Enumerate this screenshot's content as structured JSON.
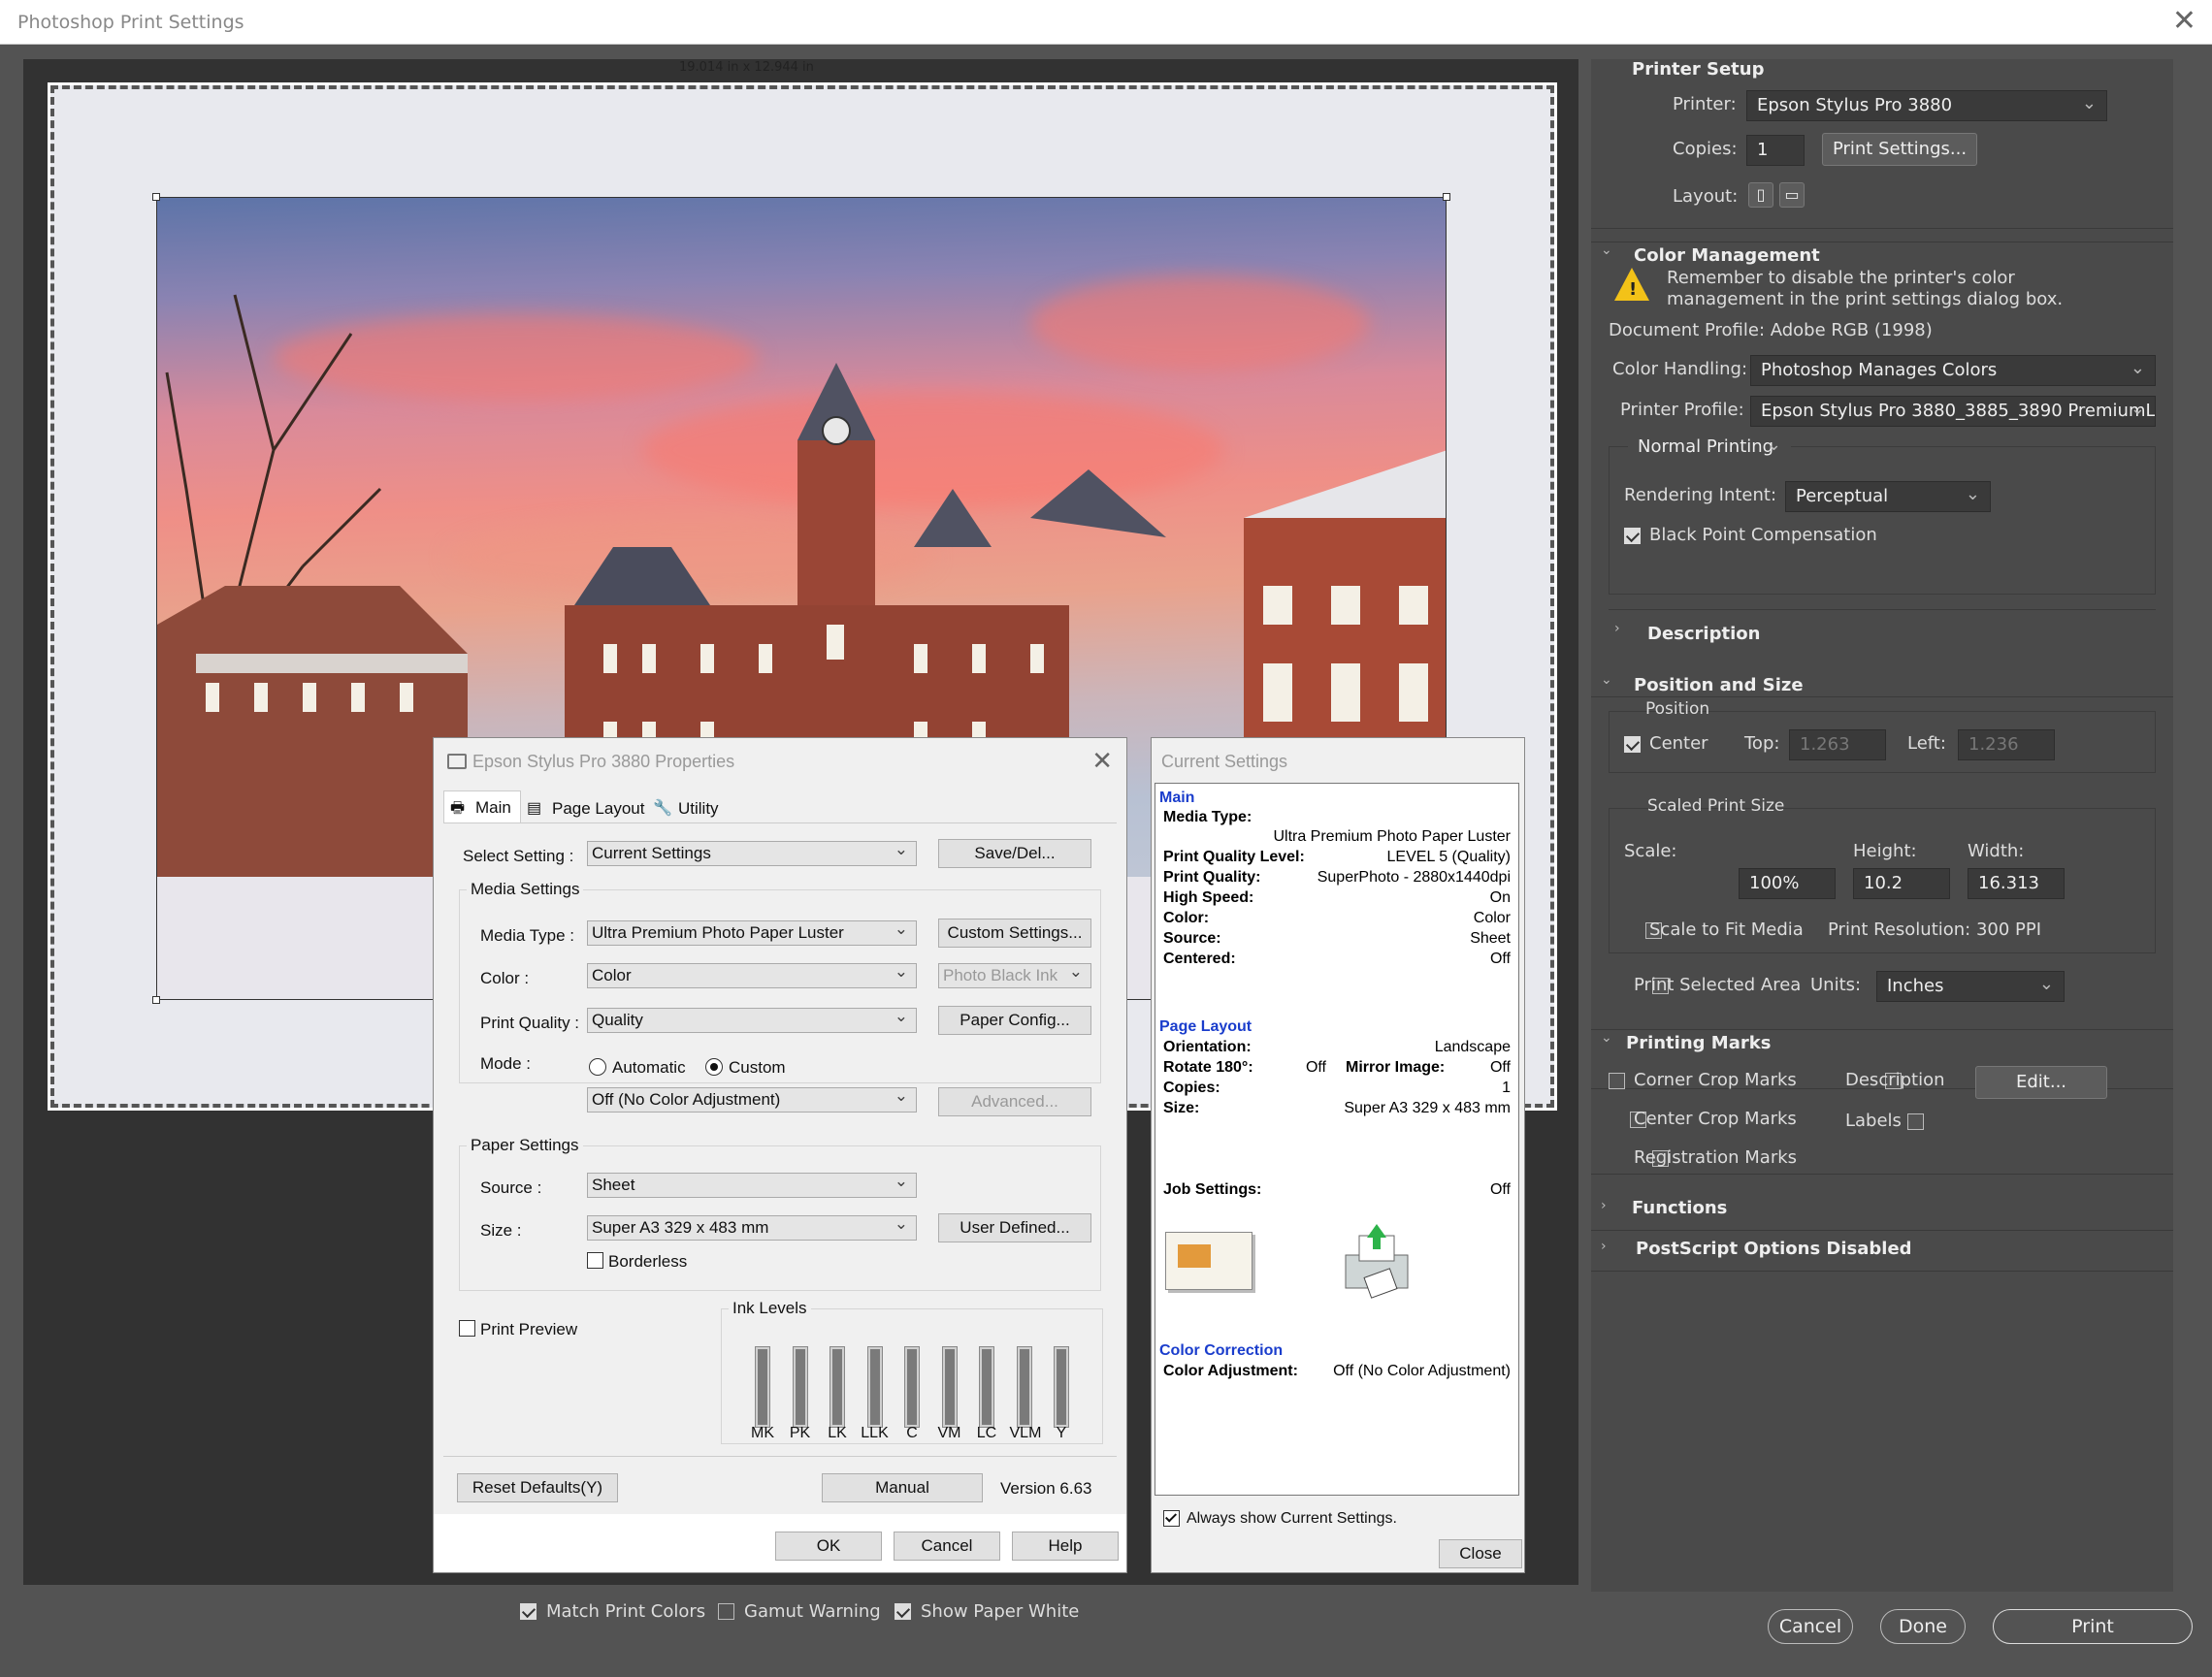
{
  "window": {
    "title": "Photoshop Print Settings",
    "close_glyph": "✕"
  },
  "preview": {
    "dimensions": "19.014 in x 12.944 in",
    "match_print_colors": {
      "label": "Match Print Colors",
      "checked": true
    },
    "gamut_warning": {
      "label": "Gamut Warning",
      "checked": false
    },
    "show_paper_white": {
      "label": "Show Paper White",
      "checked": true
    }
  },
  "printer_setup": {
    "header": "Printer Setup",
    "printer_label": "Printer:",
    "printer_value": "Epson Stylus Pro 3880",
    "copies_label": "Copies:",
    "copies_value": "1",
    "print_settings_button": "Print Settings...",
    "layout_label": "Layout:"
  },
  "color_management": {
    "header": "Color Management",
    "warning": "Remember to disable the printer's color management in the print settings dialog box.",
    "warning_line1": "Remember to disable the printer's color",
    "warning_line2": "management in the print settings dialog box.",
    "document_profile": "Document Profile: Adobe RGB (1998)",
    "color_handling_label": "Color Handling:",
    "color_handling_value": "Photoshop Manages Colors",
    "printer_profile_label": "Printer Profile:",
    "printer_profile_value": "Epson Stylus Pro 3880_3885_3890 PremiumL...",
    "print_mode_value": "Normal Printing",
    "rendering_intent_label": "Rendering Intent:",
    "rendering_intent_value": "Perceptual",
    "black_point": {
      "label": "Black Point Compensation",
      "checked": true
    }
  },
  "description": {
    "header": "Description"
  },
  "position_and_size": {
    "header": "Position and Size",
    "position_group": "Position",
    "center": {
      "label": "Center",
      "checked": true
    },
    "top_label": "Top:",
    "top_value": "1.263",
    "left_label": "Left:",
    "left_value": "1.236",
    "scaled_group": "Scaled Print Size",
    "scale_label": "Scale:",
    "scale_value": "100%",
    "height_label": "Height:",
    "height_value": "10.2",
    "width_label": "Width:",
    "width_value": "16.313",
    "scale_to_fit": {
      "label": "Scale to Fit Media",
      "checked": false
    },
    "print_resolution": "Print Resolution: 300 PPI",
    "print_selected_area": {
      "label": "Print Selected Area",
      "checked": false
    },
    "units_label": "Units:",
    "units_value": "Inches"
  },
  "printing_marks": {
    "header": "Printing Marks",
    "corner_crop": "Corner Crop Marks",
    "center_crop": "Center Crop Marks",
    "registration": "Registration Marks",
    "description": "Description",
    "labels": "Labels",
    "edit_button": "Edit..."
  },
  "functions": {
    "header": "Functions"
  },
  "postscript": {
    "header": "PostScript Options Disabled"
  },
  "footer": {
    "cancel": "Cancel",
    "done": "Done",
    "print": "Print"
  },
  "epson": {
    "title": "Epson Stylus Pro 3880 Properties",
    "tabs": [
      "Main",
      "Page Layout",
      "Utility"
    ],
    "select_setting_label": "Select Setting :",
    "select_setting_value": "Current Settings",
    "save_del": "Save/Del...",
    "media_settings": "Media Settings",
    "media_type_label": "Media Type :",
    "media_type_value": "Ultra Premium Photo Paper Luster",
    "custom_settings": "Custom Settings...",
    "color_label": "Color :",
    "color_value": "Color",
    "photo_black_ink": "Photo Black Ink",
    "print_quality_label": "Print Quality :",
    "print_quality_value": "Quality",
    "paper_config": "Paper Config...",
    "mode_label": "Mode :",
    "automatic": "Automatic",
    "custom": "Custom",
    "mode_value": "Off (No Color Adjustment)",
    "advanced": "Advanced...",
    "paper_settings": "Paper Settings",
    "source_label": "Source :",
    "source_value": "Sheet",
    "size_label": "Size :",
    "size_value": "Super A3 329 x 483 mm",
    "user_defined": "User Defined...",
    "borderless": "Borderless",
    "print_preview": "Print Preview",
    "ink_levels": "Ink Levels",
    "inks": [
      "MK",
      "PK",
      "LK",
      "LLK",
      "C",
      "VM",
      "LC",
      "VLM",
      "Y"
    ],
    "reset_defaults": "Reset Defaults(Y)",
    "manual": "Manual",
    "version": "Version 6.63",
    "ok": "OK",
    "cancel": "Cancel",
    "help": "Help"
  },
  "current_settings": {
    "title": "Current Settings",
    "main_header": "Main",
    "media_type_k": "Media Type:",
    "media_type_v": "Ultra Premium Photo Paper Luster",
    "pql_k": "Print Quality Level:",
    "pql_v": "LEVEL 5 (Quality)",
    "pq_k": "Print Quality:",
    "pq_v": "SuperPhoto - 2880x1440dpi",
    "hs_k": "High Speed:",
    "hs_v": "On",
    "color_k": "Color:",
    "color_v": "Color",
    "source_k": "Source:",
    "source_v": "Sheet",
    "centered_k": "Centered:",
    "centered_v": "Off",
    "page_layout_header": "Page Layout",
    "orientation_k": "Orientation:",
    "orientation_v": "Landscape",
    "rotate_k": "Rotate 180°:",
    "rotate_v": "Off",
    "mirror_k": "Mirror Image:",
    "mirror_v": "Off",
    "copies_k": "Copies:",
    "copies_v": "1",
    "size_k": "Size:",
    "size_v": "Super A3 329 x 483 mm",
    "job_k": "Job Settings:",
    "job_v": "Off",
    "cc_header": "Color Correction",
    "ca_k": "Color Adjustment:",
    "ca_v": "Off (No Color Adjustment)",
    "always_show": "Always show Current Settings.",
    "close": "Close"
  }
}
